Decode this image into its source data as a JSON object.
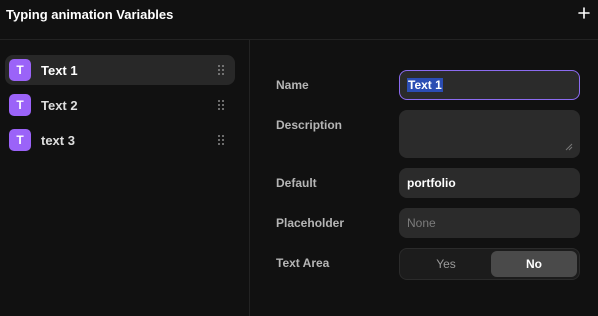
{
  "header": {
    "title": "Typing animation Variables",
    "add_icon": "plus-icon"
  },
  "sidebar": {
    "items": [
      {
        "label": "Text 1",
        "icon": "T",
        "active": true
      },
      {
        "label": "Text 2",
        "icon": "T",
        "active": false
      },
      {
        "label": "text 3",
        "icon": "T",
        "active": false
      }
    ]
  },
  "form": {
    "name": {
      "label": "Name",
      "value": "Text 1"
    },
    "description": {
      "label": "Description",
      "value": ""
    },
    "default": {
      "label": "Default",
      "value": "portfolio"
    },
    "placeholder": {
      "label": "Placeholder",
      "placeholder": "None"
    },
    "text_area": {
      "label": "Text Area",
      "options": [
        "Yes",
        "No"
      ],
      "selected": "No"
    }
  },
  "colors": {
    "background": "#111111",
    "accent": "#9b63f8",
    "focus_border": "#8b6bf0",
    "selection": "#2b4db3",
    "field": "#2b2b2b"
  }
}
